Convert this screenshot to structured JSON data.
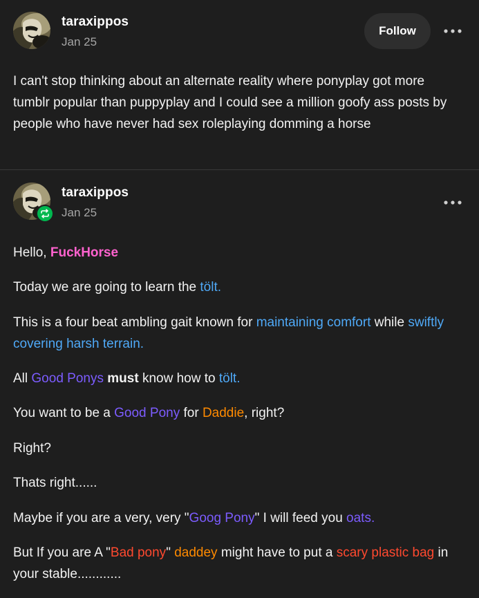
{
  "original_post": {
    "username": "taraxippos",
    "date": "Jan 25",
    "follow_label": "Follow",
    "more_icon": "more-dots-icon",
    "body": "I can't stop thinking about an alternate reality where ponyplay got more tumblr popular than puppyplay and I could see a million goofy ass posts by people who have never had sex roleplaying domming a horse"
  },
  "reblog": {
    "username": "taraxippos",
    "date": "Jan 25",
    "badge_icon": "reblog-icon",
    "more_icon": "more-dots-icon",
    "paragraphs": {
      "p1": {
        "a": "Hello, ",
        "b": "FuckHorse"
      },
      "p2": {
        "a": "Today we are going to learn the ",
        "b": "tölt."
      },
      "p3": {
        "a": "This is a four beat ambling gait known for ",
        "b": "maintaining comfort",
        "c": " while ",
        "d": "swiftly covering harsh terrain."
      },
      "p4": {
        "a": "All ",
        "b": "Good Ponys",
        "c": " ",
        "d": "must",
        "e": " know how to ",
        "f": "tölt."
      },
      "p5": {
        "a": "You want to be a ",
        "b": "Good Pony",
        "c": " for ",
        "d": "Daddie",
        "e": ", right?"
      },
      "p6": {
        "a": "Right?"
      },
      "p7": {
        "a": "Thats right......"
      },
      "p8": {
        "a": "Maybe if you are a very, very \"",
        "b": "Goog Pony",
        "c": "\" I will feed you ",
        "d": "oats."
      },
      "p9": {
        "a": "But If you are A \"",
        "b": "Bad pony",
        "c": "\" ",
        "d": "daddey",
        "e": " might have to put a ",
        "f": "scary plastic bag",
        "g": " in your stable............"
      }
    }
  },
  "colors": {
    "background": "#1e1e1e",
    "pink": "#ff62ce",
    "blue": "#4fa9f7",
    "purple": "#7c5cff",
    "orange": "#ff8a00",
    "red": "#ff492f",
    "reblog_badge": "#00b84f"
  }
}
